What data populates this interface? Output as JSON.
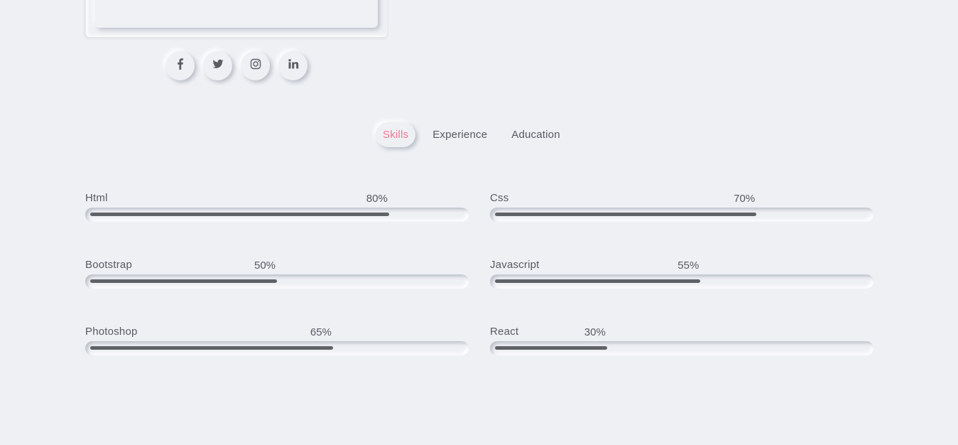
{
  "socials": [
    {
      "icon": "facebook-icon"
    },
    {
      "icon": "twitter-icon"
    },
    {
      "icon": "instagram-icon"
    },
    {
      "icon": "linkedin-icon"
    }
  ],
  "tabs": [
    {
      "label": "Skills",
      "active": true
    },
    {
      "label": "Experience",
      "active": false
    },
    {
      "label": "Aducation",
      "active": false
    }
  ],
  "skills": [
    {
      "name": "Html",
      "percent_label": "80%",
      "value": 80
    },
    {
      "name": "Css",
      "percent_label": "70%",
      "value": 70
    },
    {
      "name": "Bootstrap",
      "percent_label": "50%",
      "value": 50
    },
    {
      "name": "Javascript",
      "percent_label": "55%",
      "value": 55
    },
    {
      "name": "Photoshop",
      "percent_label": "65%",
      "value": 65
    },
    {
      "name": "React",
      "percent_label": "30%",
      "value": 30
    }
  ],
  "colors": {
    "background": "#eff0f4",
    "accent": "#f0798f",
    "bar": "#5f6267",
    "text": "#555a60"
  }
}
